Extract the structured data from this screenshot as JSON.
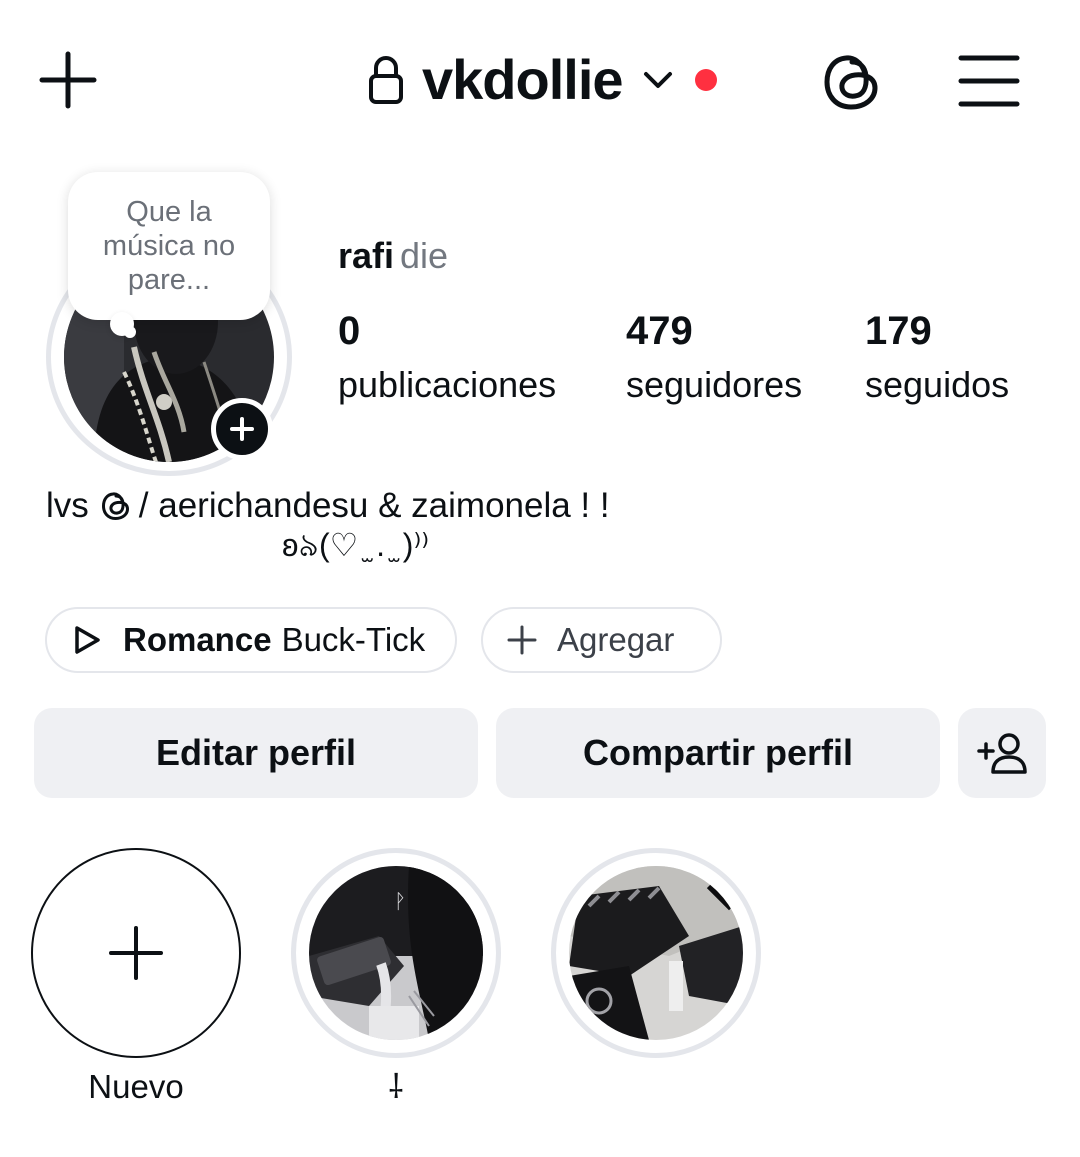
{
  "header": {
    "username": "vkdollie",
    "notification_dot_color": "#ff3040",
    "icons": [
      "plus-icon",
      "lock-icon",
      "chevron-down-icon",
      "threads-icon",
      "menu-icon"
    ]
  },
  "profile": {
    "note": "Que la música no pare...",
    "display_name": "rafi",
    "pronouns": "die",
    "stats": [
      {
        "value": "0",
        "label": "publicaciones"
      },
      {
        "value": "479",
        "label": "seguidores"
      },
      {
        "value": "179",
        "label": "seguidos"
      }
    ],
    "bio": {
      "prefix": "lvs",
      "text": "/  aerichandesu & zaimonela ! !",
      "line2": "ʚ৯(♡ ̫ . ̫ )⁾⁾"
    }
  },
  "chips": {
    "music_song": "Romance",
    "music_artist": "Buck-Tick",
    "add_label": "Agregar"
  },
  "buttons": {
    "edit": "Editar perfil",
    "share": "Compartir perfil"
  },
  "highlights": [
    {
      "label": "Nuevo"
    },
    {
      "label": "⸸"
    },
    {
      "label": ""
    }
  ]
}
